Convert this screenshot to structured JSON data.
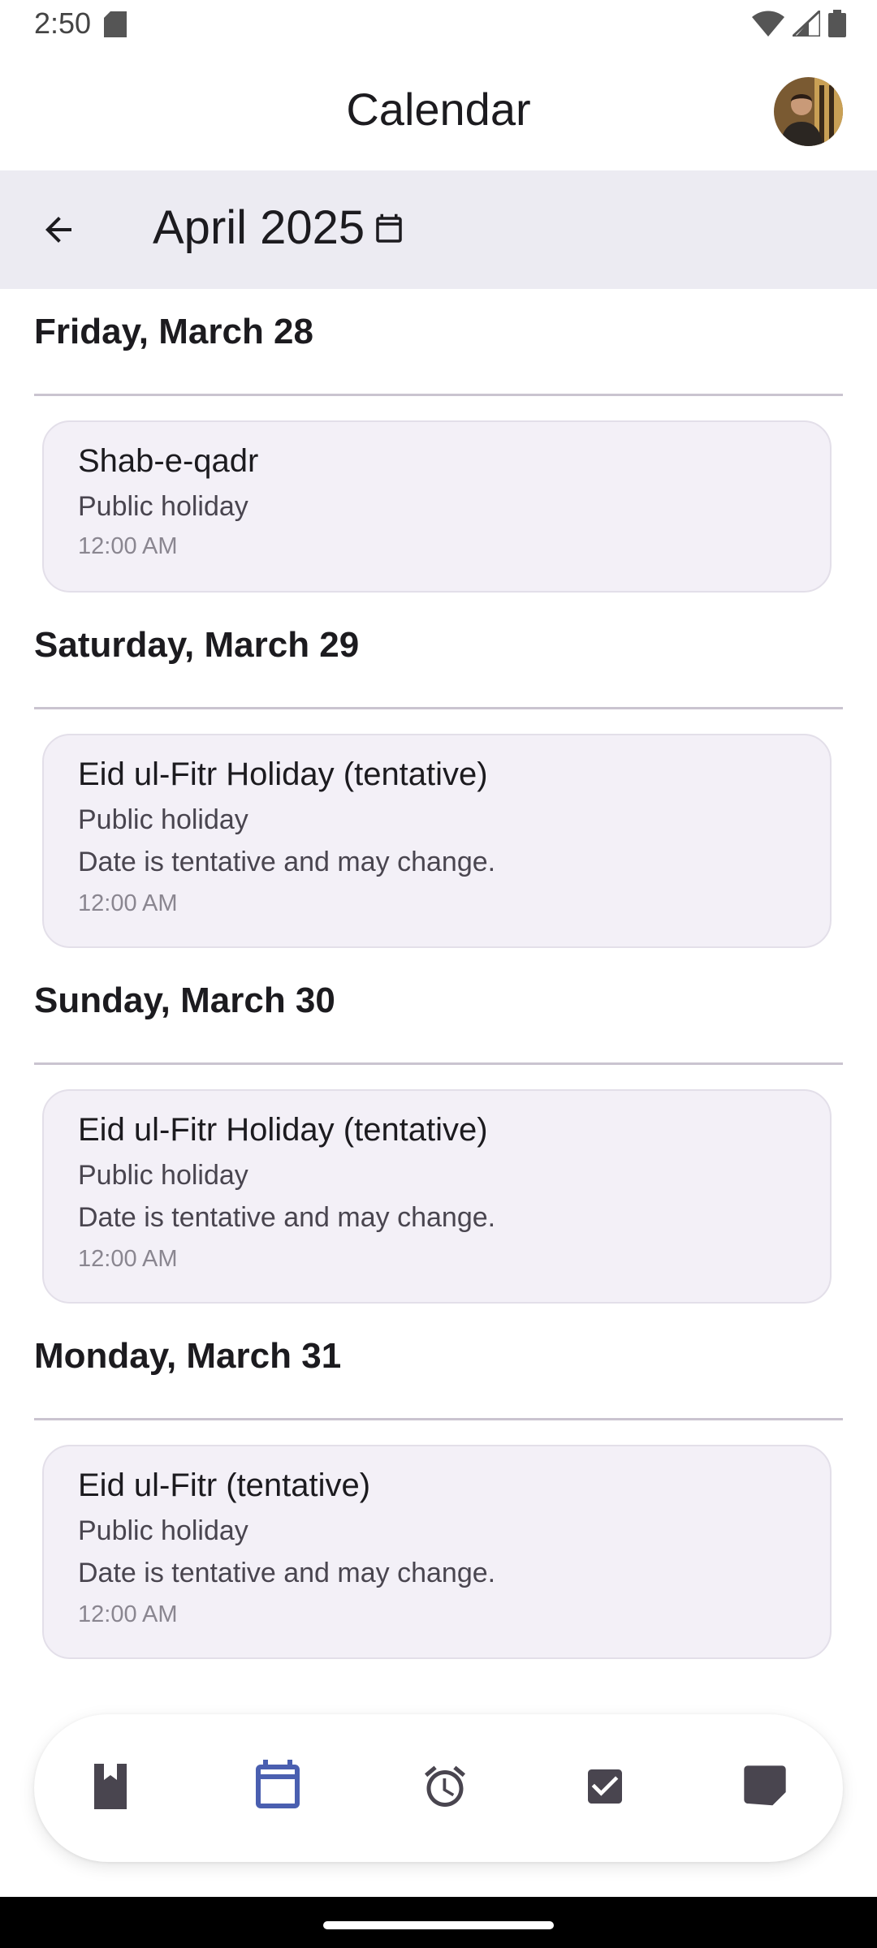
{
  "status_bar": {
    "time": "2:50"
  },
  "app_bar": {
    "title": "Calendar"
  },
  "month_bar": {
    "label": "April 2025"
  },
  "days": [
    {
      "header": "Friday, March 28",
      "events": [
        {
          "title": "Shab-e-qadr",
          "subtitle": "Public holiday",
          "note": "",
          "time": "12:00 AM"
        }
      ]
    },
    {
      "header": "Saturday, March 29",
      "events": [
        {
          "title": "Eid ul-Fitr Holiday (tentative)",
          "subtitle": "Public holiday",
          "note": "Date is tentative and may change.",
          "time": "12:00 AM"
        }
      ]
    },
    {
      "header": "Sunday, March 30",
      "events": [
        {
          "title": "Eid ul-Fitr Holiday (tentative)",
          "subtitle": "Public holiday",
          "note": "Date is tentative and may change.",
          "time": "12:00 AM"
        }
      ]
    },
    {
      "header": "Monday, March 31",
      "events": [
        {
          "title": "Eid ul-Fitr (tentative)",
          "subtitle": "Public holiday",
          "note": "Date is tentative and may change.",
          "time": "12:00 AM"
        }
      ]
    }
  ],
  "bottom_nav": {
    "items": [
      {
        "icon": "bookmark-book-icon",
        "active": false
      },
      {
        "icon": "calendar-icon",
        "active": true
      },
      {
        "icon": "alarm-icon",
        "active": false
      },
      {
        "icon": "checkbox-icon",
        "active": false
      },
      {
        "icon": "note-icon",
        "active": false
      }
    ]
  },
  "colors": {
    "accent": "#4a5fb0",
    "icon": "#49454f",
    "month_bar_bg": "#ecebf2",
    "card_bg": "#f3f0f7"
  }
}
